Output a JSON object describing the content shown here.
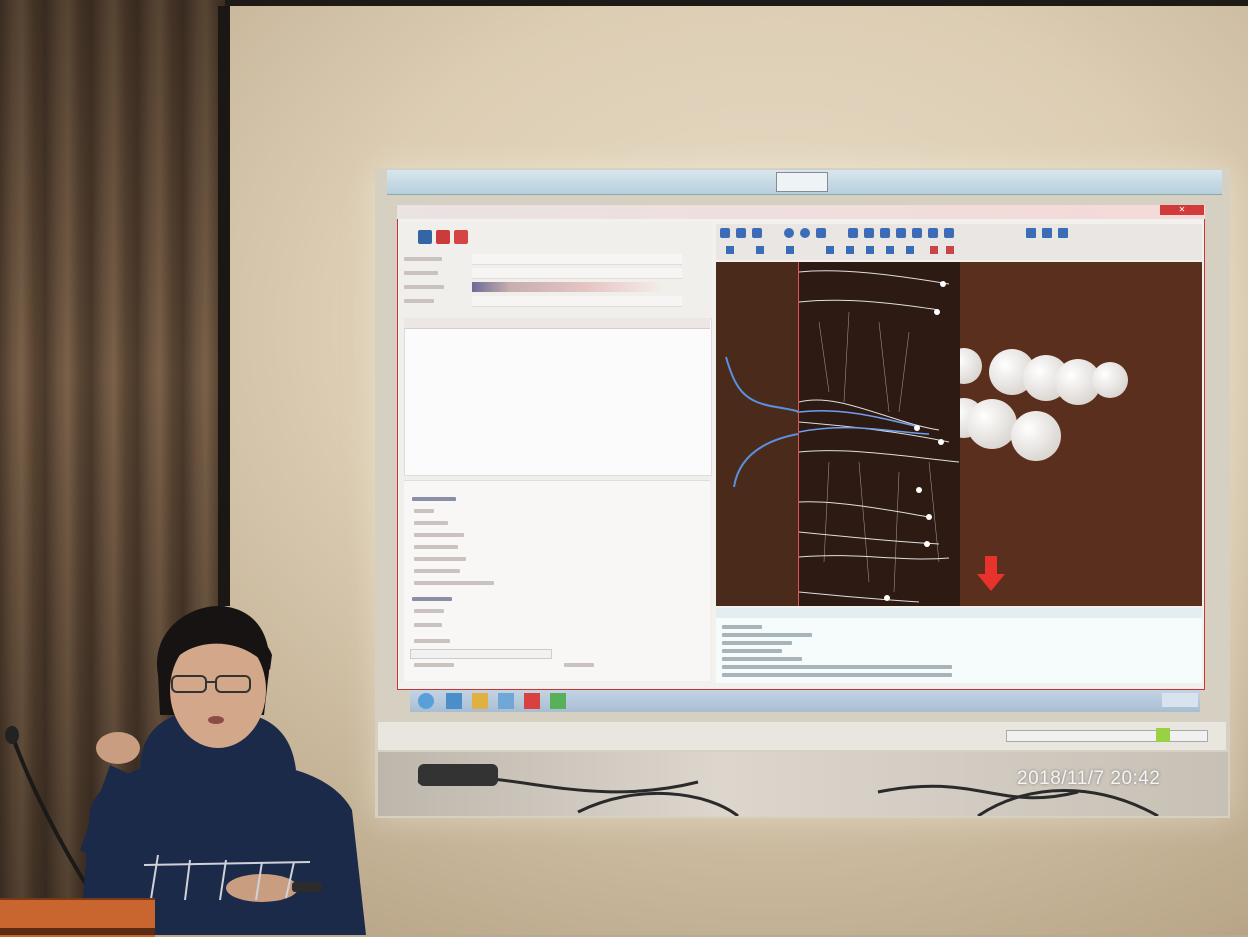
{
  "scene": {
    "timestamp": "2018/11/7  20:42",
    "hoodie_text": "POURYTROS",
    "arrow_color": "#e8322c",
    "wall_color": "#dccdb3",
    "curtain_color": "#6b5440",
    "hoodie_color": "#1c2a4a",
    "podium_color": "#c9652f"
  },
  "icons": {
    "arrow": "down-arrow-icon",
    "close": "close-icon",
    "start": "windows-start-icon"
  }
}
